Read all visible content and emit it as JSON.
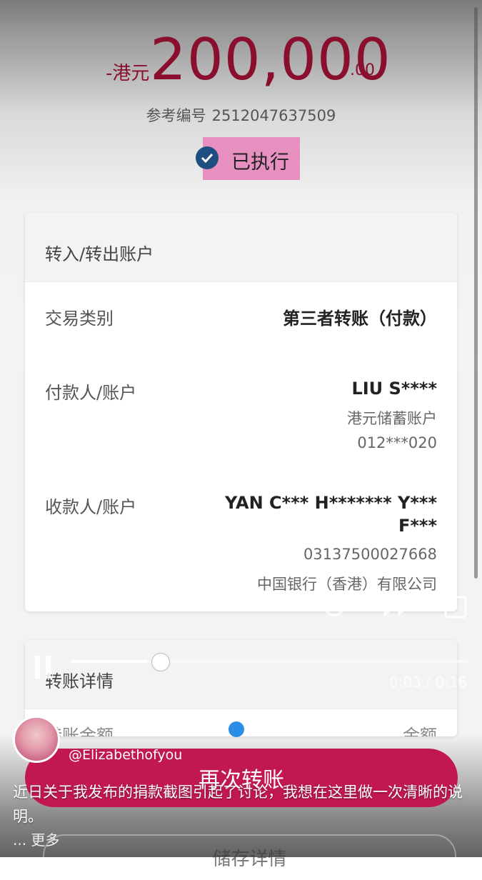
{
  "amount": {
    "prefix": "-港元",
    "main": "200,000",
    "cents": ".00"
  },
  "reference": {
    "label": "参考编号",
    "number": "2512047637509"
  },
  "status": {
    "label": "已执行"
  },
  "account_card": {
    "header": "转入/转出账户",
    "transaction_type": {
      "label": "交易类别",
      "value": "第三者转账（付款）"
    },
    "payer": {
      "label": "付款人/账户",
      "name": "LIU S****",
      "account_type": "港元储蓄账户",
      "account_no": "012***020"
    },
    "payee": {
      "label": "收款人/账户",
      "name_line1": "YAN C*** H******* Y***",
      "name_line2": "F***",
      "account_no": "03137500027668",
      "bank": "中国银行（香港）有限公司"
    }
  },
  "details_card": {
    "header": "转账详情",
    "partial_left": "转账金额",
    "partial_right": "金额"
  },
  "video": {
    "time": "0:03 / 0:16",
    "progress": 0.19
  },
  "button": {
    "transfer_again": "再次转账"
  },
  "social": {
    "username": "@Elizabethofyou",
    "caption": "近日关于我发布的捐款截图引起了讨论，我想在这里做一次清晰的说明。",
    "more": "... 更多",
    "hidden_button": "储存详情"
  },
  "colors": {
    "accent": "#8a0e2e",
    "button": "#c0184f",
    "check": "#1f4f82",
    "highlight": "#e880b8"
  }
}
